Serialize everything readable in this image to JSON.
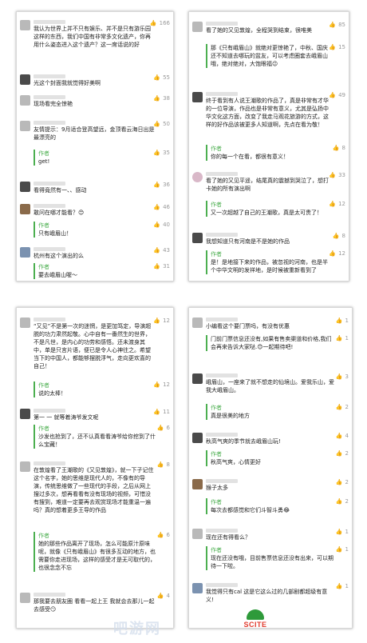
{
  "panels": [
    {
      "comments": [
        {
          "likes": "166",
          "text": "我认为世界上并不只有娱乐、并不是只有游乐园这样的东西，我们中国有非常多文化遗产，你再用什么姿态进入这个遗产？这一席话说的好"
        },
        {
          "likes": "55",
          "text": "光这个封面我就觉得好美啊"
        },
        {
          "likes": "38",
          "text": "现场看完全惊艳"
        },
        {
          "likes": "50",
          "text": "友情提示：9月适合登高望远，金顶看云海日出是最漂亮的"
        },
        {
          "likes": "35",
          "text": "",
          "author_tag": "作者",
          "reply": "get!"
        },
        {
          "likes": "36",
          "text": "看得竟然有一、、感动"
        },
        {
          "likes": "46",
          "text": "敢问在哪才能看？😊"
        },
        {
          "likes": "40",
          "text": "",
          "author_tag": "作者",
          "reply": "只有峨眉山！"
        },
        {
          "likes": "43",
          "text": "杭州有这个演出的么"
        },
        {
          "likes": "31",
          "text": "",
          "author_tag": "作者",
          "reply": "要去峨眉山喔～"
        }
      ]
    },
    {
      "comments": [
        {
          "likes": "85",
          "text": "看了她的又见敦煌，全程哭到结束，很唯美"
        },
        {
          "likes": "15",
          "text": "那《只有峨眉山》就绝对更惊艳了，中秋、国庆还不知道去哪玩的盆友，可以考虑圈套去峨眉山哦，绝对绝对，大饱眼福😉"
        },
        {
          "likes": "49",
          "text": "终于看到有人说王潮歌的作品了，真是非常有才华的一位导演，作品也是非常有意义，尤其是弘扬中华文化这方面，改变了我走马观花旅游的方式，这样的好作品该被更多人知道啊，先点在看为敬！"
        },
        {
          "likes": "8",
          "text": "",
          "author_tag": "作者",
          "reply": "你的每一个在看，都很有意义！"
        },
        {
          "likes": "33",
          "text": "看了她的又见平遥，结尾真的震撼到哭泣了，想打卡她的所有演出啊"
        },
        {
          "likes": "12",
          "text": "",
          "author_tag": "作者",
          "reply": "又一次超越了自己的王潮歌，真是太可贵了！"
        },
        {
          "likes": "8",
          "text": "我想知道只有河南是不是她的作品"
        },
        {
          "likes": "12",
          "text": "",
          "author_tag": "作者",
          "reply": "是！是地接下来的作品，被忽视的河南，也是半个中华文明的发祥地，是时候被重新看到了"
        }
      ]
    },
    {
      "comments": [
        {
          "likes": "12",
          "text": "“又见”不是第一次的迷惘，是更加笃定，导演超脱的功力肃然起敬。心中自有一番然生的世界，不是凡世，是内心的功劳和感悟。还未渡身其中，单是只言片语，便已是令人心神往之。希望当下的中国人，都能够摆脱浮气，走向更欢喜的自己！"
        },
        {
          "likes": "12",
          "text": "",
          "author_tag": "作者",
          "reply": "说的太棒！"
        },
        {
          "likes": "11",
          "text": "第一 一 就等着涛爷发文呢"
        },
        {
          "likes": "6",
          "text": "",
          "author_tag": "作者",
          "reply": "沙发也抢到了，还不认真看看涛爷给你挖到了什么宝藏！"
        },
        {
          "likes": "8",
          "text": "在敦煌看了王潮歌的《又见敦煌》，就一下子记住这个名字，她的思维是现代人的，不像有的导演，传统思维做了一些现代的手段，之后从网上搜过多次，想再看看有没有现场的视频，可惜没有搜到，难道一定要再去观赏现场才能重温一遍吗？真的想着更多王导的作品"
        },
        {
          "likes": "6",
          "text": "",
          "author_tag": "作者",
          "reply": "她的那些作品离开了现场，怎么可能原汁原味呢，就像《只有峨眉山》有很多互动的地方，也需要你走进现场，这样的感受才是无可取代的，也很念念不忘"
        },
        {
          "likes": "4",
          "text": "那我要去朋友圈 看看一起上王 我就会去那儿一起去感受😏"
        }
      ]
    },
    {
      "comments": [
        {
          "likes": "1",
          "text": "小编看这个要门票吗，有没有优惠"
        },
        {
          "likes": "1",
          "text": "",
          "author_tag": "作者",
          "reply": "门前门票信息还没有,如果有售卖渠道和价格,我们会再来告诉大家哒.😊一起期待吧!"
        },
        {
          "likes": "3",
          "text": "峨眉山，一座来了就不想走的仙境山。爱我乐山，爱我大峨眉山。"
        },
        {
          "likes": "2",
          "text": "",
          "author_tag": "作者",
          "reply": "真是很美的地方"
        },
        {
          "likes": "4",
          "text": "秋高气爽的季节就去峨眉山玩!"
        },
        {
          "likes": "2",
          "text": "",
          "author_tag": "作者",
          "reply": "秋高气爽，心情更好"
        },
        {
          "likes": "2",
          "text": "猴子太多"
        },
        {
          "likes": "2",
          "text": "",
          "author_tag": "作者",
          "reply": "每次去都感觉和它们斗智斗勇😂"
        },
        {
          "likes": "1",
          "text": "现在还有得看么？"
        },
        {
          "likes": "1",
          "text": "",
          "author_tag": "作者",
          "reply": "现在还没有哦，目前售票信息还没有出来，可以期待一下啦。"
        },
        {
          "likes": "1",
          "text": "我觉得只有cal 这是它这么过的几部剧都超级有意义!"
        }
      ]
    }
  ],
  "watermark": "吧游网",
  "logo": {
    "text": "SCITE",
    "color": "#e23b2e",
    "mark_color": "#2e9a3a"
  },
  "colors": {
    "author_accent": "#4caf50",
    "likes": "#999999"
  },
  "icons": {
    "like": "thumbs-up-icon"
  }
}
